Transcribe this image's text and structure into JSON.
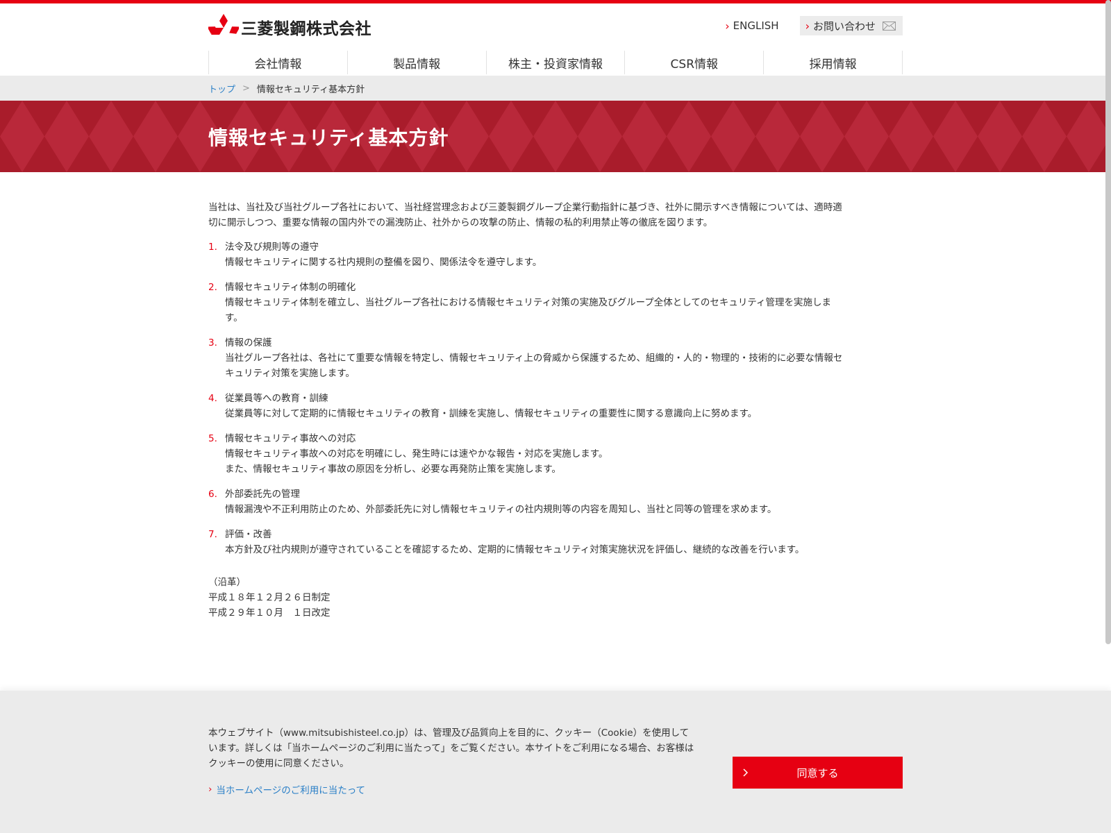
{
  "header": {
    "logo_text": "三菱製鋼株式会社",
    "english_label": "ENGLISH",
    "contact_label": "お問い合わせ"
  },
  "nav": {
    "company": "会社情報",
    "products": "製品情報",
    "investors": "株主・投資家情報",
    "csr": "CSR情報",
    "careers": "採用情報"
  },
  "breadcrumb": {
    "home": "トップ",
    "separator": ">",
    "current": "情報セキュリティ基本方針"
  },
  "hero": {
    "title": "情報セキュリティ基本方針"
  },
  "policy": {
    "intro": "当社は、当社及び当社グループ各社において、当社経営理念および三菱製鋼グループ企業行動指針に基づき、社外に開示すべき情報については、適時適切に開示しつつ、重要な情報の国内外での漏洩防止、社外からの攻撃の防止、情報の私的利用禁止等の徹底を図ります。",
    "items": [
      {
        "num": "1.",
        "title": "法令及び規則等の遵守",
        "body": "情報セキュリティに関する社内規則の整備を図り、関係法令を遵守します。"
      },
      {
        "num": "2.",
        "title": "情報セキュリティ体制の明確化",
        "body": "情報セキュリティ体制を確立し、当社グループ各社における情報セキュリティ対策の実施及びグループ全体としてのセキュリティ管理を実施します。"
      },
      {
        "num": "3.",
        "title": "情報の保護",
        "body": "当社グループ各社は、各社にて重要な情報を特定し、情報セキュリティ上の脅威から保護するため、組織的・人的・物理的・技術的に必要な情報セキュリティ対策を実施します。"
      },
      {
        "num": "4.",
        "title": "従業員等への教育・訓練",
        "body": "従業員等に対して定期的に情報セキュリティの教育・訓練を実施し、情報セキュリティの重要性に関する意識向上に努めます。"
      },
      {
        "num": "5.",
        "title": "情報セキュリティ事故への対応",
        "body": "情報セキュリティ事故への対応を明確にし、発生時には速やかな報告・対応を実施します。",
        "body2": "また、情報セキュリティ事故の原因を分析し、必要な再発防止策を実施します。"
      },
      {
        "num": "6.",
        "title": "外部委託先の管理",
        "body": "情報漏洩や不正利用防止のため、外部委託先に対し情報セキュリティの社内規則等の内容を周知し、当社と同等の管理を求めます。"
      },
      {
        "num": "7.",
        "title": "評価・改善",
        "body": "本方針及び社内規則が遵守されていることを確認するため、定期的に情報セキュリティ対策実施状況を評価し、継続的な改善を行います。"
      }
    ],
    "history": {
      "heading": "（沿革）",
      "established": "平成１８年１２月２６日制定",
      "revised": "平成２９年１０月　１日改定"
    }
  },
  "cookie": {
    "text": "本ウェブサイト（www.mitsubishisteel.co.jp）は、管理及び品質向上を目的に、クッキー（Cookie）を使用しています。詳しくは「当ホームページのご利用に当たって」をご覧ください。本サイトをご利用になる場合、お客様はクッキーの使用に同意ください。",
    "link_label": "当ホームページのご利用に当たって",
    "agree_label": "同意する"
  },
  "colors": {
    "accent_red": "#e60012",
    "hero_red": "#b2202f",
    "link_blue": "#2a7fc7"
  }
}
